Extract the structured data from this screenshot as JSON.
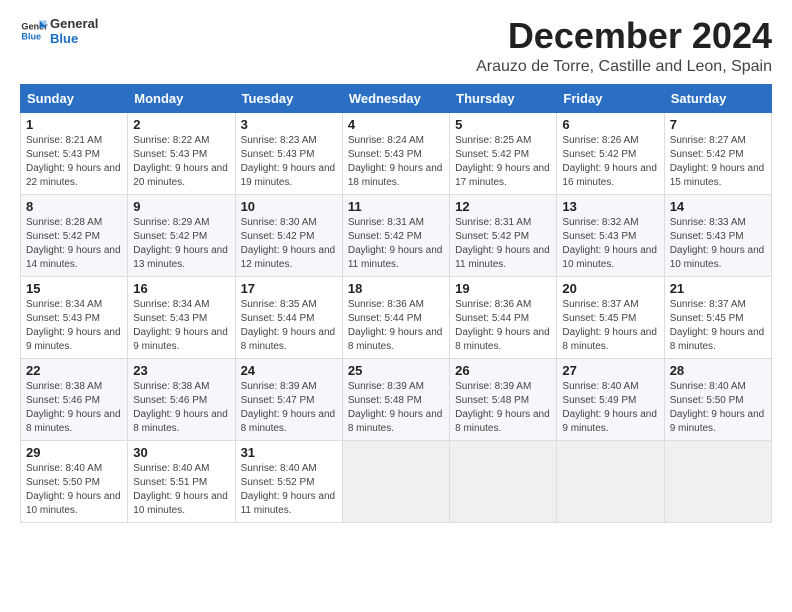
{
  "header": {
    "logo_text_general": "General",
    "logo_text_blue": "Blue",
    "month_title": "December 2024",
    "subtitle": "Arauzo de Torre, Castille and Leon, Spain"
  },
  "calendar": {
    "days_of_week": [
      "Sunday",
      "Monday",
      "Tuesday",
      "Wednesday",
      "Thursday",
      "Friday",
      "Saturday"
    ],
    "weeks": [
      [
        null,
        {
          "day": "2",
          "sunrise": "Sunrise: 8:22 AM",
          "sunset": "Sunset: 5:43 PM",
          "daylight": "Daylight: 9 hours and 20 minutes."
        },
        {
          "day": "3",
          "sunrise": "Sunrise: 8:23 AM",
          "sunset": "Sunset: 5:43 PM",
          "daylight": "Daylight: 9 hours and 19 minutes."
        },
        {
          "day": "4",
          "sunrise": "Sunrise: 8:24 AM",
          "sunset": "Sunset: 5:43 PM",
          "daylight": "Daylight: 9 hours and 18 minutes."
        },
        {
          "day": "5",
          "sunrise": "Sunrise: 8:25 AM",
          "sunset": "Sunset: 5:42 PM",
          "daylight": "Daylight: 9 hours and 17 minutes."
        },
        {
          "day": "6",
          "sunrise": "Sunrise: 8:26 AM",
          "sunset": "Sunset: 5:42 PM",
          "daylight": "Daylight: 9 hours and 16 minutes."
        },
        {
          "day": "7",
          "sunrise": "Sunrise: 8:27 AM",
          "sunset": "Sunset: 5:42 PM",
          "daylight": "Daylight: 9 hours and 15 minutes."
        }
      ],
      [
        {
          "day": "8",
          "sunrise": "Sunrise: 8:28 AM",
          "sunset": "Sunset: 5:42 PM",
          "daylight": "Daylight: 9 hours and 14 minutes."
        },
        {
          "day": "9",
          "sunrise": "Sunrise: 8:29 AM",
          "sunset": "Sunset: 5:42 PM",
          "daylight": "Daylight: 9 hours and 13 minutes."
        },
        {
          "day": "10",
          "sunrise": "Sunrise: 8:30 AM",
          "sunset": "Sunset: 5:42 PM",
          "daylight": "Daylight: 9 hours and 12 minutes."
        },
        {
          "day": "11",
          "sunrise": "Sunrise: 8:31 AM",
          "sunset": "Sunset: 5:42 PM",
          "daylight": "Daylight: 9 hours and 11 minutes."
        },
        {
          "day": "12",
          "sunrise": "Sunrise: 8:31 AM",
          "sunset": "Sunset: 5:42 PM",
          "daylight": "Daylight: 9 hours and 11 minutes."
        },
        {
          "day": "13",
          "sunrise": "Sunrise: 8:32 AM",
          "sunset": "Sunset: 5:43 PM",
          "daylight": "Daylight: 9 hours and 10 minutes."
        },
        {
          "day": "14",
          "sunrise": "Sunrise: 8:33 AM",
          "sunset": "Sunset: 5:43 PM",
          "daylight": "Daylight: 9 hours and 10 minutes."
        }
      ],
      [
        {
          "day": "15",
          "sunrise": "Sunrise: 8:34 AM",
          "sunset": "Sunset: 5:43 PM",
          "daylight": "Daylight: 9 hours and 9 minutes."
        },
        {
          "day": "16",
          "sunrise": "Sunrise: 8:34 AM",
          "sunset": "Sunset: 5:43 PM",
          "daylight": "Daylight: 9 hours and 9 minutes."
        },
        {
          "day": "17",
          "sunrise": "Sunrise: 8:35 AM",
          "sunset": "Sunset: 5:44 PM",
          "daylight": "Daylight: 9 hours and 8 minutes."
        },
        {
          "day": "18",
          "sunrise": "Sunrise: 8:36 AM",
          "sunset": "Sunset: 5:44 PM",
          "daylight": "Daylight: 9 hours and 8 minutes."
        },
        {
          "day": "19",
          "sunrise": "Sunrise: 8:36 AM",
          "sunset": "Sunset: 5:44 PM",
          "daylight": "Daylight: 9 hours and 8 minutes."
        },
        {
          "day": "20",
          "sunrise": "Sunrise: 8:37 AM",
          "sunset": "Sunset: 5:45 PM",
          "daylight": "Daylight: 9 hours and 8 minutes."
        },
        {
          "day": "21",
          "sunrise": "Sunrise: 8:37 AM",
          "sunset": "Sunset: 5:45 PM",
          "daylight": "Daylight: 9 hours and 8 minutes."
        }
      ],
      [
        {
          "day": "22",
          "sunrise": "Sunrise: 8:38 AM",
          "sunset": "Sunset: 5:46 PM",
          "daylight": "Daylight: 9 hours and 8 minutes."
        },
        {
          "day": "23",
          "sunrise": "Sunrise: 8:38 AM",
          "sunset": "Sunset: 5:46 PM",
          "daylight": "Daylight: 9 hours and 8 minutes."
        },
        {
          "day": "24",
          "sunrise": "Sunrise: 8:39 AM",
          "sunset": "Sunset: 5:47 PM",
          "daylight": "Daylight: 9 hours and 8 minutes."
        },
        {
          "day": "25",
          "sunrise": "Sunrise: 8:39 AM",
          "sunset": "Sunset: 5:48 PM",
          "daylight": "Daylight: 9 hours and 8 minutes."
        },
        {
          "day": "26",
          "sunrise": "Sunrise: 8:39 AM",
          "sunset": "Sunset: 5:48 PM",
          "daylight": "Daylight: 9 hours and 8 minutes."
        },
        {
          "day": "27",
          "sunrise": "Sunrise: 8:40 AM",
          "sunset": "Sunset: 5:49 PM",
          "daylight": "Daylight: 9 hours and 9 minutes."
        },
        {
          "day": "28",
          "sunrise": "Sunrise: 8:40 AM",
          "sunset": "Sunset: 5:50 PM",
          "daylight": "Daylight: 9 hours and 9 minutes."
        }
      ],
      [
        {
          "day": "29",
          "sunrise": "Sunrise: 8:40 AM",
          "sunset": "Sunset: 5:50 PM",
          "daylight": "Daylight: 9 hours and 10 minutes."
        },
        {
          "day": "30",
          "sunrise": "Sunrise: 8:40 AM",
          "sunset": "Sunset: 5:51 PM",
          "daylight": "Daylight: 9 hours and 10 minutes."
        },
        {
          "day": "31",
          "sunrise": "Sunrise: 8:40 AM",
          "sunset": "Sunset: 5:52 PM",
          "daylight": "Daylight: 9 hours and 11 minutes."
        },
        null,
        null,
        null,
        null
      ]
    ],
    "first_week_day1": {
      "day": "1",
      "sunrise": "Sunrise: 8:21 AM",
      "sunset": "Sunset: 5:43 PM",
      "daylight": "Daylight: 9 hours and 22 minutes."
    }
  }
}
